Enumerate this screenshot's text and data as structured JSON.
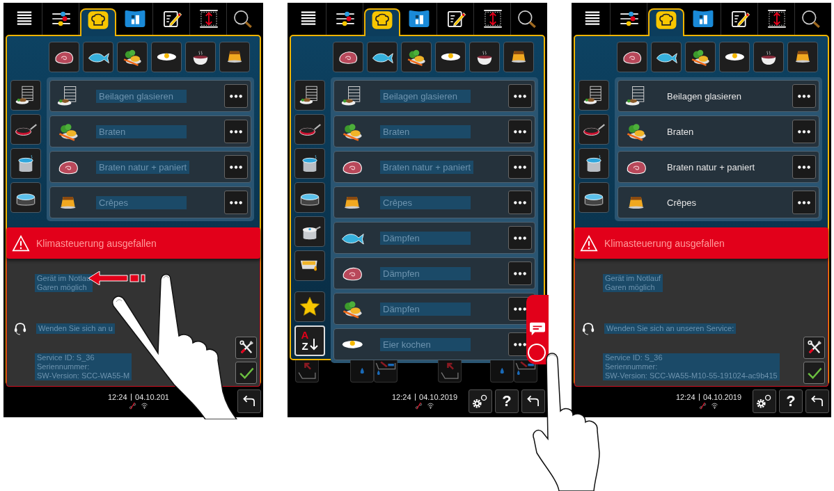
{
  "screens": [
    {
      "tabs": [
        {
          "kind": "menu",
          "selected": false
        },
        {
          "kind": "filters",
          "selected": false
        },
        {
          "kind": "chef",
          "selected": true
        },
        {
          "kind": "dashboard",
          "selected": false
        },
        {
          "kind": "edit",
          "selected": false
        },
        {
          "kind": "resize",
          "selected": false
        },
        {
          "kind": "search",
          "selected": false
        }
      ],
      "categories": [
        {
          "kind": "meat"
        },
        {
          "kind": "fish"
        },
        {
          "kind": "vegetables"
        },
        {
          "kind": "egg"
        },
        {
          "kind": "soup"
        },
        {
          "kind": "dessert"
        }
      ],
      "sidebar": [
        {
          "kind": "tray"
        },
        {
          "kind": "pan"
        },
        {
          "kind": "pot"
        },
        {
          "kind": "casserole"
        }
      ],
      "rows": [
        {
          "kind": "tray",
          "label": "Beilagen glasieren",
          "highlighted": true
        },
        {
          "kind": "vegetables",
          "label": "Braten",
          "highlighted": true
        },
        {
          "kind": "meat",
          "label": "Braten natur + paniert",
          "highlighted": true
        },
        {
          "kind": "dessert",
          "label": "Crêpes",
          "highlighted": true
        }
      ],
      "alert": {
        "title": "Klimasteuerung ausgefallen",
        "status_lines": [
          "Gerät im Notlau",
          "Garen möglich"
        ],
        "service_prompt": "Wenden Sie sich an u",
        "info_lines": [
          "Service ID: S_36",
          "Seriennummer:",
          "SW-Version: SCC-WA55-M"
        ],
        "highlighted": true
      },
      "status": {
        "time": "12:24",
        "date": "04.10.201"
      },
      "buttons": [
        {
          "kind": "back"
        }
      ],
      "gesture": {
        "kind": "swipe"
      }
    },
    {
      "tabs": [
        {
          "kind": "menu",
          "selected": false
        },
        {
          "kind": "filters",
          "selected": false
        },
        {
          "kind": "chef",
          "selected": true
        },
        {
          "kind": "dashboard",
          "selected": false
        },
        {
          "kind": "edit",
          "selected": false
        },
        {
          "kind": "resize",
          "selected": false
        },
        {
          "kind": "search",
          "selected": false
        }
      ],
      "categories": [
        {
          "kind": "meat"
        },
        {
          "kind": "fish"
        },
        {
          "kind": "vegetables"
        },
        {
          "kind": "egg"
        },
        {
          "kind": "soup"
        },
        {
          "kind": "dessert"
        }
      ],
      "sidebar": [
        {
          "kind": "tray"
        },
        {
          "kind": "pan"
        },
        {
          "kind": "pot"
        },
        {
          "kind": "casserole"
        },
        {
          "kind": "pressure"
        },
        {
          "kind": "fryer"
        },
        {
          "kind": "star"
        },
        {
          "kind": "sort",
          "top": "A",
          "bottom": "Z"
        }
      ],
      "rows": [
        {
          "kind": "tray",
          "label": "Beilagen glasieren",
          "highlighted": true
        },
        {
          "kind": "vegetables",
          "label": "Braten",
          "highlighted": true
        },
        {
          "kind": "meat",
          "label": "Braten natur + paniert",
          "highlighted": true
        },
        {
          "kind": "dessert",
          "label": "Crêpes",
          "highlighted": true
        },
        {
          "kind": "fish",
          "label": "Dämpfen",
          "highlighted": true
        },
        {
          "kind": "meat",
          "label": "Dämpfen",
          "highlighted": true
        },
        {
          "kind": "vegetables",
          "label": "Dämpfen",
          "highlighted": true
        },
        {
          "kind": "egg",
          "label": "Eier kochen",
          "highlighted": true
        }
      ],
      "control_strip": [
        {
          "kind": "tray_out"
        },
        {
          "kind": "drop"
        },
        {
          "kind": "drop_tray"
        },
        {
          "kind": "tray_out"
        },
        {
          "kind": "drop"
        },
        {
          "kind": "drop_tray"
        }
      ],
      "chat_tab": true,
      "status": {
        "time": "12:24",
        "date": "04.10.2019"
      },
      "buttons": [
        {
          "kind": "settings"
        },
        {
          "kind": "help",
          "label": "?"
        },
        {
          "kind": "back"
        }
      ],
      "gesture": {
        "kind": "tap"
      }
    },
    {
      "tabs": [
        {
          "kind": "menu",
          "selected": false
        },
        {
          "kind": "filters",
          "selected": false
        },
        {
          "kind": "chef",
          "selected": true
        },
        {
          "kind": "dashboard",
          "selected": false
        },
        {
          "kind": "edit",
          "selected": false
        },
        {
          "kind": "resize",
          "selected": false
        },
        {
          "kind": "search",
          "selected": false
        }
      ],
      "categories": [
        {
          "kind": "meat"
        },
        {
          "kind": "fish"
        },
        {
          "kind": "vegetables"
        },
        {
          "kind": "egg"
        },
        {
          "kind": "soup"
        },
        {
          "kind": "dessert"
        }
      ],
      "sidebar": [
        {
          "kind": "tray"
        },
        {
          "kind": "pan"
        },
        {
          "kind": "pot"
        },
        {
          "kind": "casserole"
        }
      ],
      "rows": [
        {
          "kind": "tray",
          "label": "Beilagen glasieren",
          "highlighted": false
        },
        {
          "kind": "vegetables",
          "label": "Braten",
          "highlighted": false
        },
        {
          "kind": "meat",
          "label": "Braten natur + paniert",
          "highlighted": false
        },
        {
          "kind": "dessert",
          "label": "Crêpes",
          "highlighted": false
        }
      ],
      "alert": {
        "title": "Klimasteuerung ausgefallen",
        "status_lines": [
          "Gerät im Notlauf",
          "Garen möglich"
        ],
        "service_prompt": "Wenden Sie sich an unseren Service:",
        "info_lines": [
          "Service ID: S_36",
          "Seriennummer:",
          "SW-Version: SCC-WA55-M10-55-191024-ac9b415"
        ],
        "highlighted": true
      },
      "status": {
        "time": "12:24",
        "date": "04.10.2019"
      },
      "buttons": [
        {
          "kind": "settings"
        },
        {
          "kind": "help",
          "label": "?"
        },
        {
          "kind": "back"
        }
      ]
    }
  ]
}
